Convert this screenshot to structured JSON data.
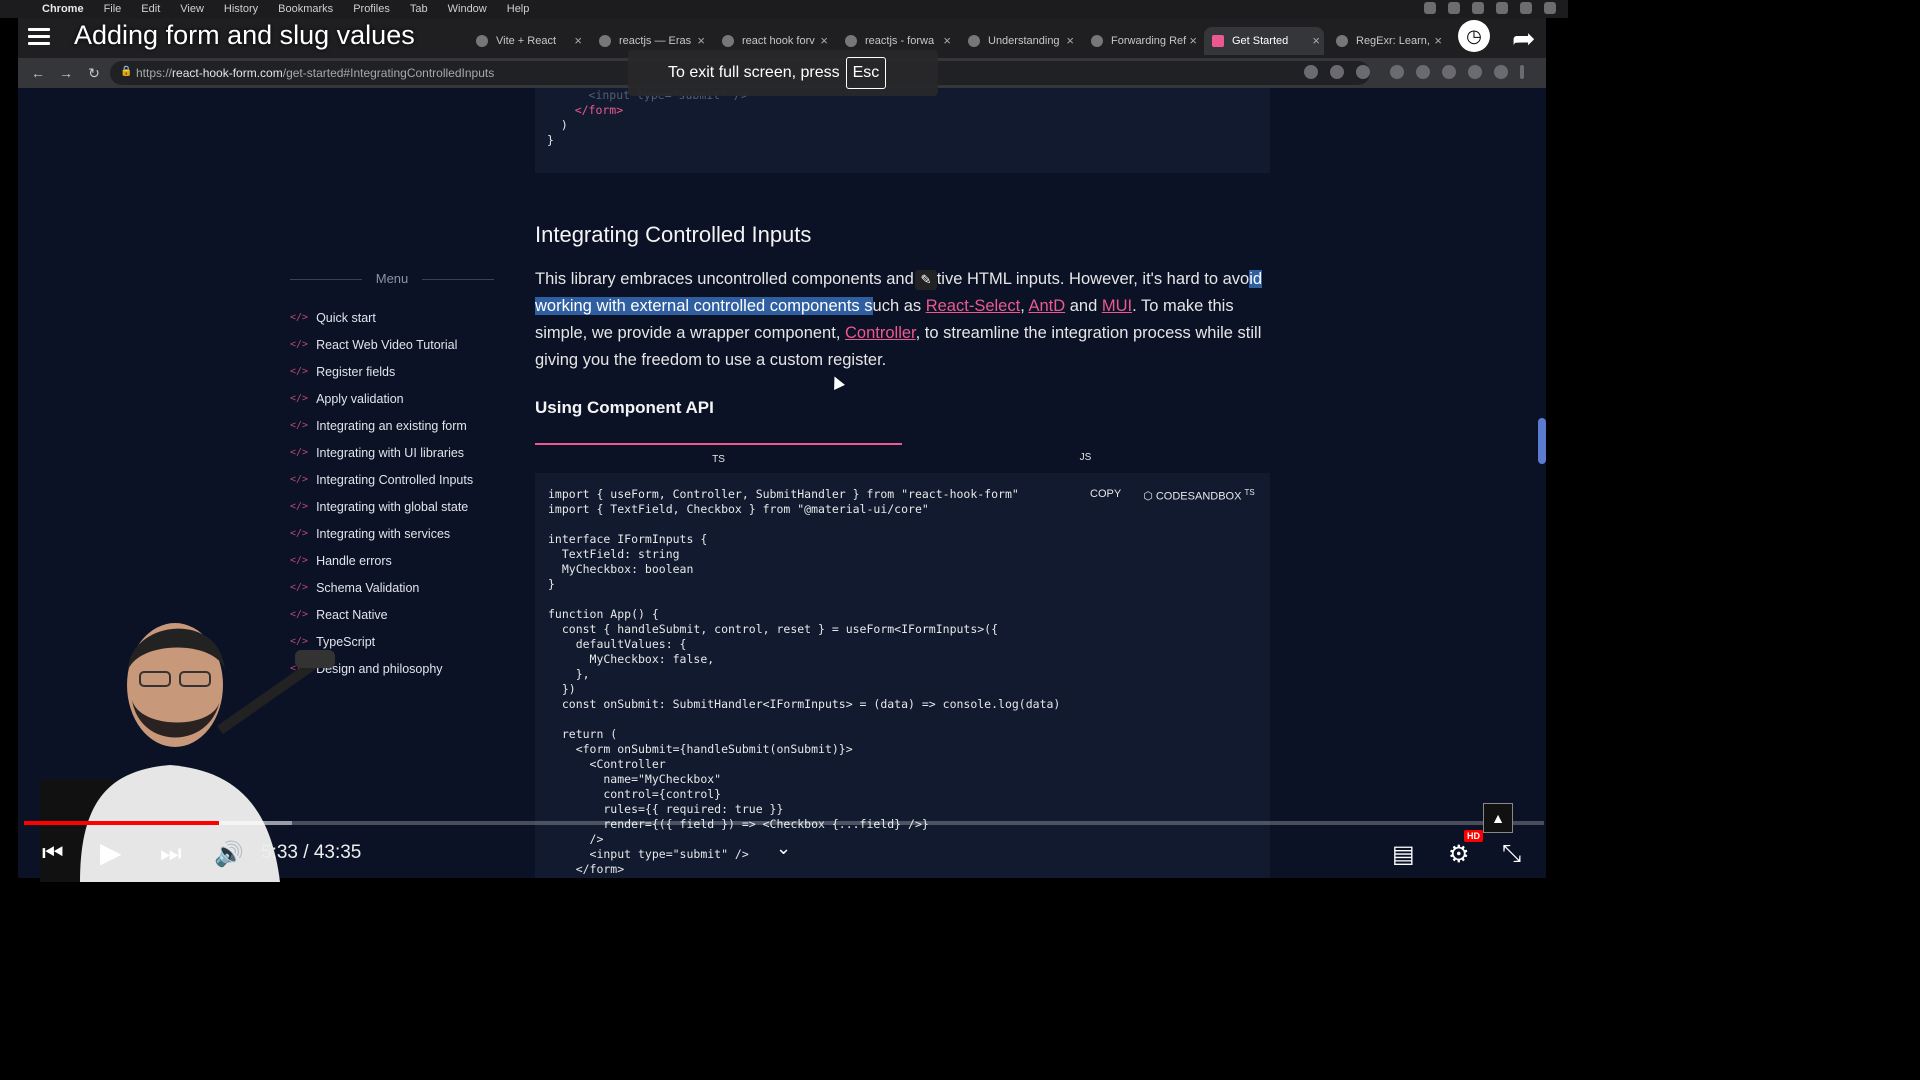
{
  "mac_menu": {
    "app": "Chrome",
    "items": [
      "File",
      "Edit",
      "View",
      "History",
      "Bookmarks",
      "Profiles",
      "Tab",
      "Window",
      "Help"
    ]
  },
  "browser": {
    "tabs": [
      {
        "label": "Vite + React"
      },
      {
        "label": "reactjs — Eras"
      },
      {
        "label": "react hook forv"
      },
      {
        "label": "reactjs - forwa"
      },
      {
        "label": "Understanding"
      },
      {
        "label": "Forwarding Ref"
      },
      {
        "label": "Get Started"
      },
      {
        "label": "RegExr: Learn,"
      }
    ],
    "url_prefix": "https://",
    "url_host": "react-hook-form.com",
    "url_path": "/get-started#IntegratingControlledInputs"
  },
  "fullscreen_notice": {
    "text": "To exit full screen, press",
    "key": "Esc"
  },
  "page": {
    "top_code": [
      "      <input type=\"submit\" />",
      "    </form>",
      "  )",
      "}"
    ],
    "section_title": "Integrating Controlled Inputs",
    "paragraph": {
      "p1": "This library embraces uncontrolled components and native HTML inputs. However, it's hard to avo",
      "highlight": "id working with external controlled components s",
      "p2": "uch as ",
      "link1": "React-Select",
      "sep1": ", ",
      "link2": "AntD",
      "and": " and ",
      "link3": "MUI",
      "p3": ". To make this simple, we provide a wrapper component, ",
      "link4": "Controller",
      "p4": ", to streamline the integration process while still giving you the freedom to use a custom register."
    },
    "subsection_title": "Using Component API",
    "code_tabs": [
      "TS",
      "JS"
    ],
    "copy_label": "COPY",
    "codesandbox_label": "CODESANDBOX",
    "codesandbox_sup": "TS",
    "menu": {
      "title": "Menu",
      "tag": "</>",
      "items": [
        "Quick start",
        "React Web Video Tutorial",
        "Register fields",
        "Apply validation",
        "Integrating an existing form",
        "Integrating with UI libraries",
        "Integrating Controlled Inputs",
        "Integrating with global state",
        "Integrating with services",
        "Handle errors",
        "Schema Validation",
        "React Native",
        "TypeScript",
        "Design and philosophy"
      ]
    },
    "code_lines": [
      "import { useForm, Controller, SubmitHandler } from \"react-hook-form\"",
      "import { TextField, Checkbox } from \"@material-ui/core\"",
      "",
      "interface IFormInputs {",
      "  TextField: string",
      "  MyCheckbox: boolean",
      "}",
      "",
      "function App() {",
      "  const { handleSubmit, control, reset } = useForm<IFormInputs>({",
      "    defaultValues: {",
      "      MyCheckbox: false,",
      "    },",
      "  })",
      "  const onSubmit: SubmitHandler<IFormInputs> = (data) => console.log(data)",
      "",
      "  return (",
      "    <form onSubmit={handleSubmit(onSubmit)}>",
      "      <Controller",
      "        name=\"MyCheckbox\"",
      "        control={control}",
      "        rules={{ required: true }}",
      "        render={({ field }) => <Checkbox {...field} />}",
      "      />",
      "      <input type=\"submit\" />",
      "    </form>"
    ]
  },
  "youtube": {
    "title": "Adding form and slug values",
    "current_time": "5:33",
    "duration": "43:35",
    "time_display": "5:33 / 43:35",
    "played_fraction": 0.128,
    "buffered_fraction": 0.176,
    "hd_badge": "HD"
  },
  "colors": {
    "accent": "#ec5990",
    "youtube_red": "#ff0000",
    "page_bg": "#0b1226"
  }
}
